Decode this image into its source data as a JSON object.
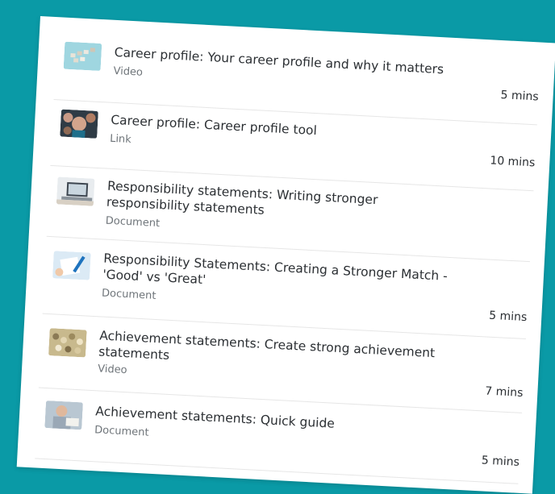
{
  "items": [
    {
      "title": "Career profile: Your career profile and why it matters",
      "type": "Video",
      "duration": "5 mins",
      "thumb_icon": "city-tiles-thumbnail"
    },
    {
      "title": "Career profile: Career profile tool",
      "type": "Link",
      "duration": "10 mins",
      "thumb_icon": "people-portraits-thumbnail"
    },
    {
      "title": "Responsibility statements: Writing stronger responsibility statements",
      "type": "Document",
      "duration": "",
      "thumb_icon": "laptop-desk-thumbnail"
    },
    {
      "title": "Responsibility Statements: Creating a Stronger Match - 'Good' vs 'Great'",
      "type": "Document",
      "duration": "5 mins",
      "thumb_icon": "paper-pen-thumbnail"
    },
    {
      "title": "Achievement statements: Create strong achievement statements",
      "type": "Video",
      "duration": "7 mins",
      "thumb_icon": "crowd-thumbnail"
    },
    {
      "title": "Achievement statements: Quick guide",
      "type": "Document",
      "duration": "5 mins",
      "thumb_icon": "man-reading-thumbnail"
    }
  ],
  "colors": {
    "background": "#0a9aa6",
    "card": "#ffffff",
    "text": "#2b2f33",
    "muted": "#6f757a"
  }
}
